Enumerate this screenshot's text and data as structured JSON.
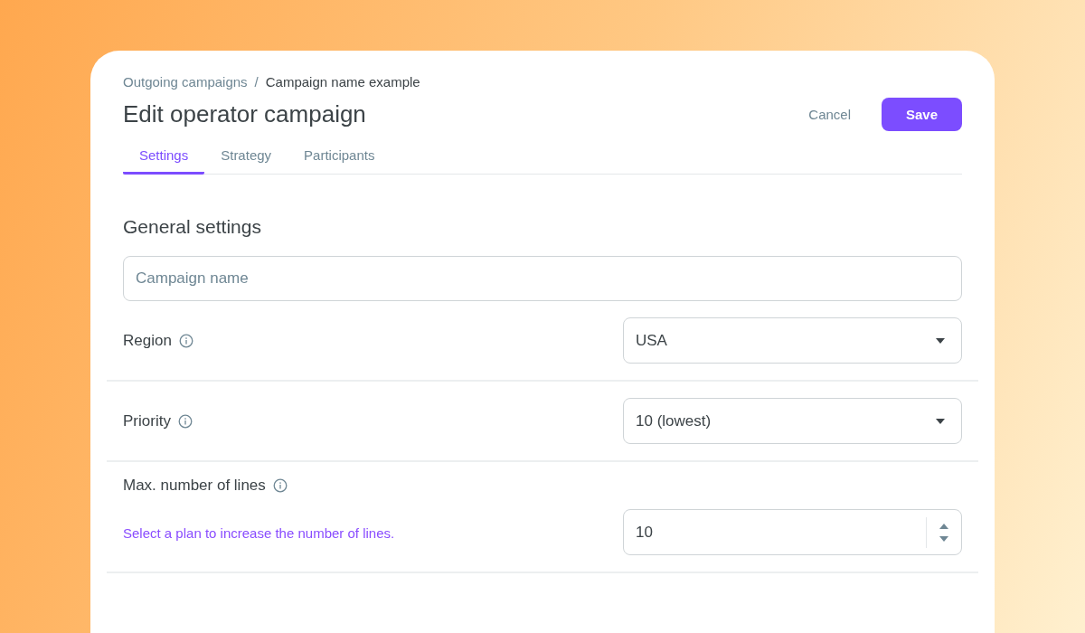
{
  "breadcrumb": [
    {
      "label": "Outgoing campaigns",
      "kind": "link"
    },
    {
      "label": "/",
      "kind": "separator"
    },
    {
      "label": "Campaign name example",
      "kind": "current"
    }
  ],
  "title": "Edit operator campaign",
  "actions": {
    "cancel": "Cancel",
    "save": "Save"
  },
  "tabs": [
    {
      "label": "Settings",
      "selected": true
    },
    {
      "label": "Strategy",
      "selected": false
    },
    {
      "label": "Participants",
      "selected": false
    }
  ],
  "section_title": "General settings",
  "name_field": {
    "placeholder": "Campaign name"
  },
  "rows": [
    {
      "kind": "select",
      "label": "Region",
      "value": "USA"
    },
    {
      "kind": "select",
      "label": "Priority",
      "value": "10 (lowest)"
    },
    {
      "kind": "number",
      "label": "Max. number of lines",
      "hint": "Select a plan to increase the number of lines.",
      "value": "10"
    }
  ]
}
